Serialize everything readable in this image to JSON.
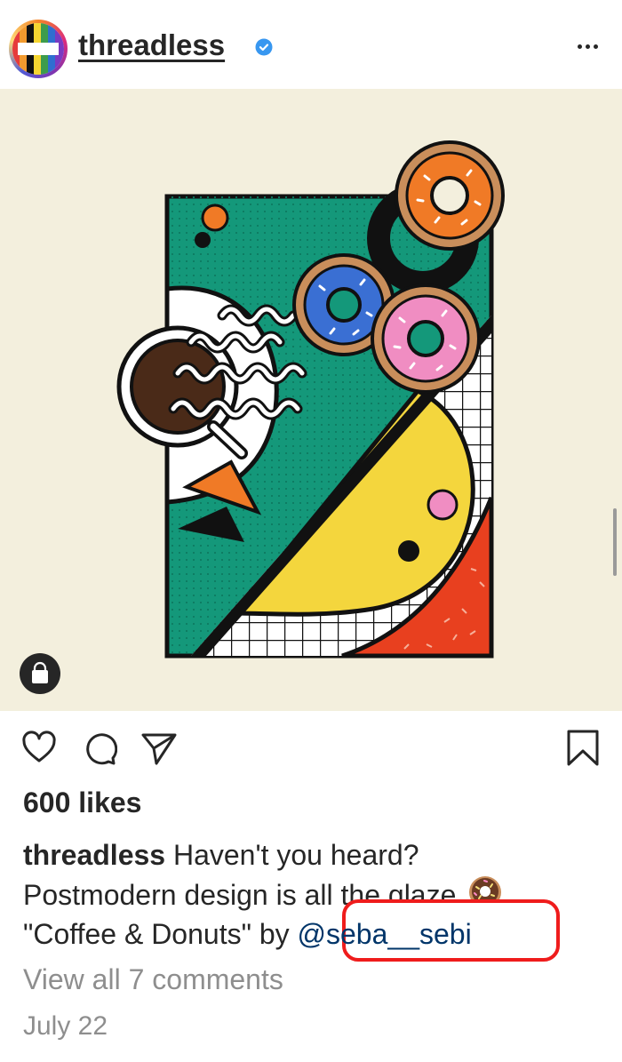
{
  "header": {
    "username": "threadless",
    "verified_icon": "verified-badge-icon",
    "more_icon": "more-options-icon",
    "avatar_text": "threadless"
  },
  "post": {
    "image_description_icon": "artwork-image",
    "shop_icon": "shopping-bag-icon"
  },
  "actions": {
    "like_icon": "heart-icon",
    "comment_icon": "comment-icon",
    "share_icon": "paper-plane-icon",
    "save_icon": "bookmark-icon"
  },
  "likes": "600 likes",
  "caption": {
    "author": "threadless",
    "line1": " Haven't you heard?",
    "line2": "Postmodern design is all the glaze.",
    "line3_prefix": "\"Coffee & Donuts\" by ",
    "mention": "@seba__sebi"
  },
  "view_comments": "View all 7 comments",
  "date": "July 22",
  "colors": {
    "background": "#f3efdd",
    "green": "#14987a",
    "yellow": "#f4d63d",
    "red": "#e8401f",
    "highlight": "#ef1c1c",
    "mention": "#003569"
  }
}
